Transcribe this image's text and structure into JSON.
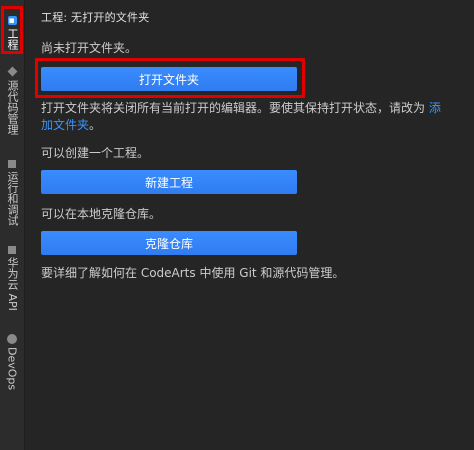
{
  "activity_bar": {
    "tabs": [
      {
        "id": "explorer",
        "label": "工程"
      },
      {
        "id": "scm",
        "label": "源代码管理"
      },
      {
        "id": "run",
        "label": "运行和调试"
      },
      {
        "id": "huawei",
        "label": "华为云 API"
      },
      {
        "id": "devops",
        "label": "DevOps"
      }
    ]
  },
  "panel": {
    "title": "工程: 无打开的文件夹",
    "no_folder_text": "尚未打开文件夹。",
    "open_folder_button": "打开文件夹",
    "open_folder_desc": "打开文件夹将关闭所有当前打开的编辑器。要使其保持打开状态，请改为",
    "add_folder_link": "添加文件夹",
    "create_project_text": "可以创建一个工程。",
    "create_project_button": "新建工程",
    "clone_text": "可以在本地克隆仓库。",
    "clone_button": "克隆仓库",
    "learn_more_text": "要详细了解如何在 CodeArts 中使用 Git 和源代码管理。"
  },
  "colors": {
    "accent": "#3794ff",
    "button": "#2f80ed",
    "highlight": "#e00000",
    "background": "#252526"
  }
}
